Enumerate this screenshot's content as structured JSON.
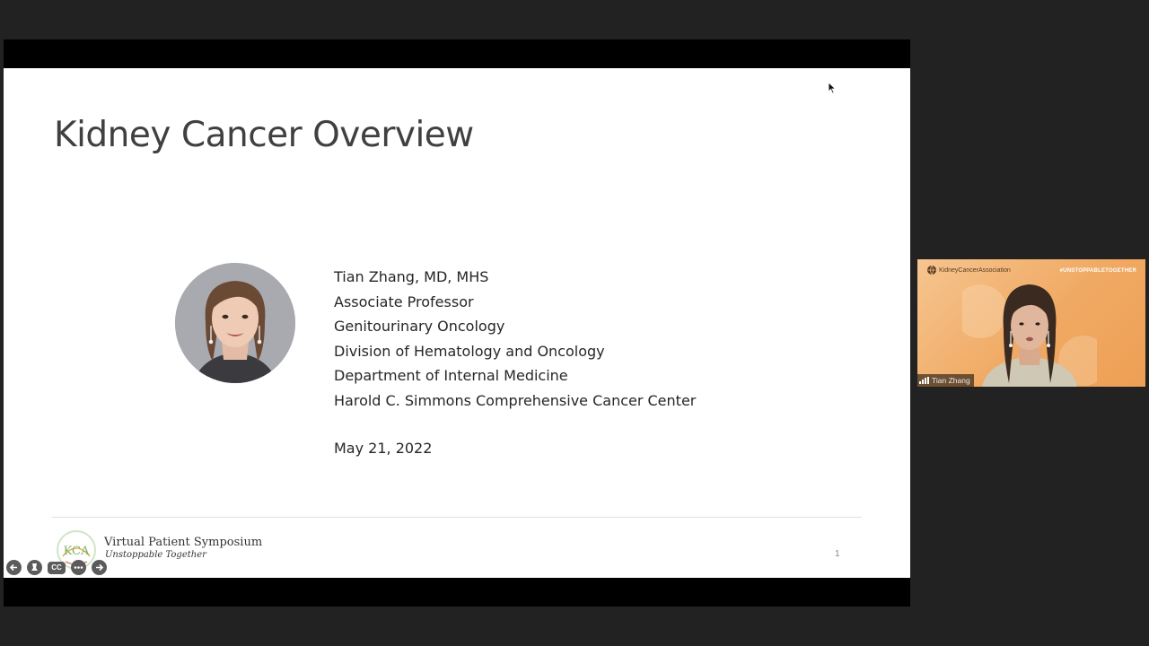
{
  "slide": {
    "title": "Kidney Cancer Overview",
    "presenter_lines": [
      "Tian Zhang, MD, MHS",
      "Associate Professor",
      "Genitourinary Oncology",
      "Division of Hematology and Oncology",
      "Department of Internal Medicine",
      "Harold C. Simmons Comprehensive Cancer Center"
    ],
    "date": "May 21, 2022",
    "footer": {
      "logo_text": "KCA",
      "event_title": "Virtual Patient Symposium",
      "event_subtitle": "Unstoppable Together",
      "page_number": "1"
    }
  },
  "slideshow_controls": {
    "items": [
      {
        "name": "previous-slide-icon",
        "label": ""
      },
      {
        "name": "pointer-tool-icon",
        "label": ""
      },
      {
        "name": "captions-icon",
        "label": "CC"
      },
      {
        "name": "more-options-icon",
        "label": ""
      },
      {
        "name": "next-slide-icon",
        "label": ""
      }
    ]
  },
  "video_tile": {
    "brand": "KidneyCancerAssociation",
    "hashtag": "#UNSTOPPABLETOGETHER",
    "participant_name": "Tian Zhang"
  },
  "colors": {
    "background": "#222222",
    "slide_background": "#ffffff",
    "title_text": "#404040",
    "tile_orange": "#f0a963"
  }
}
